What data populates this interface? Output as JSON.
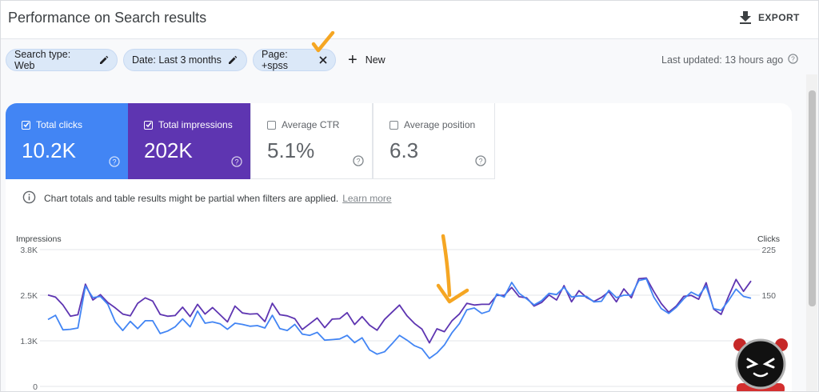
{
  "header": {
    "title": "Performance on Search results",
    "export_label": "EXPORT"
  },
  "filters": {
    "chips": [
      {
        "label": "Search type: Web",
        "action": "pencil-icon"
      },
      {
        "label": "Date: Last 3 months",
        "action": "pencil-icon"
      },
      {
        "label": "Page: +spss",
        "action": "close-icon"
      }
    ],
    "new_label": "New",
    "last_updated": "Last updated: 13 hours ago"
  },
  "metrics": [
    {
      "label": "Total clicks",
      "value": "10.2K",
      "checked": true,
      "color": "#4285f4"
    },
    {
      "label": "Total impressions",
      "value": "202K",
      "checked": true,
      "color": "#5e35b1"
    },
    {
      "label": "Average CTR",
      "value": "5.1%",
      "checked": false
    },
    {
      "label": "Average position",
      "value": "6.3",
      "checked": false
    }
  ],
  "note": {
    "text": "Chart totals and table results might be partial when filters are applied.",
    "link": "Learn more"
  },
  "annotation_color": "#f5a623",
  "chart_data": {
    "type": "line",
    "left_axis": {
      "label": "Impressions",
      "ticks": [
        "3.8K",
        "2.5K",
        "1.3K",
        "0"
      ],
      "range": [
        0,
        3800
      ]
    },
    "right_axis": {
      "label": "Clicks",
      "ticks": [
        "225",
        "150"
      ],
      "range": [
        0,
        225
      ]
    },
    "series": [
      {
        "axis": "left",
        "color": "#5e35b1",
        "values": [
          2540,
          2480,
          2260,
          1950,
          1990,
          2840,
          2400,
          2550,
          2330,
          2180,
          2010,
          1960,
          2310,
          2460,
          2370,
          2000,
          1950,
          1970,
          2200,
          1940,
          2280,
          2010,
          2190,
          1990,
          1790,
          2230,
          2040,
          2010,
          2020,
          1800,
          2310,
          1990,
          1960,
          1880,
          1580,
          1740,
          1900,
          1630,
          1870,
          1880,
          2050,
          1720,
          1940,
          1700,
          1560,
          1860,
          2060,
          2260,
          1960,
          1750,
          1590,
          1210,
          1600,
          1520,
          1820,
          2010,
          2310,
          2260,
          2280,
          2280,
          2530,
          2530,
          2750,
          2490,
          2460,
          2230,
          2330,
          2540,
          2400,
          2800,
          2350,
          2660,
          2470,
          2360,
          2470,
          2630,
          2350,
          2710,
          2460,
          2990,
          3010,
          2640,
          2300,
          2060,
          2230,
          2500,
          2530,
          2420,
          2880,
          2150,
          2000,
          2500,
          2970,
          2640,
          2930
        ]
      },
      {
        "axis": "right",
        "color": "#4285f4",
        "values": [
          110,
          117,
          93,
          94,
          96,
          165,
          146,
          148,
          135,
          106,
          92,
          107,
          95,
          108,
          108,
          87,
          91,
          98,
          111,
          98,
          124,
          104,
          106,
          103,
          94,
          104,
          102,
          99,
          100,
          96,
          117,
          95,
          92,
          102,
          86,
          84,
          89,
          76,
          77,
          78,
          84,
          72,
          80,
          60,
          53,
          57,
          70,
          84,
          76,
          67,
          62,
          46,
          55,
          68,
          88,
          103,
          126,
          129,
          120,
          124,
          152,
          147,
          171,
          153,
          144,
          134,
          141,
          153,
          151,
          163,
          147,
          149,
          148,
          139,
          140,
          158,
          146,
          150,
          150,
          174,
          177,
          147,
          128,
          120,
          130,
          144,
          155,
          149,
          165,
          128,
          125,
          141,
          160,
          148,
          145
        ]
      }
    ]
  }
}
